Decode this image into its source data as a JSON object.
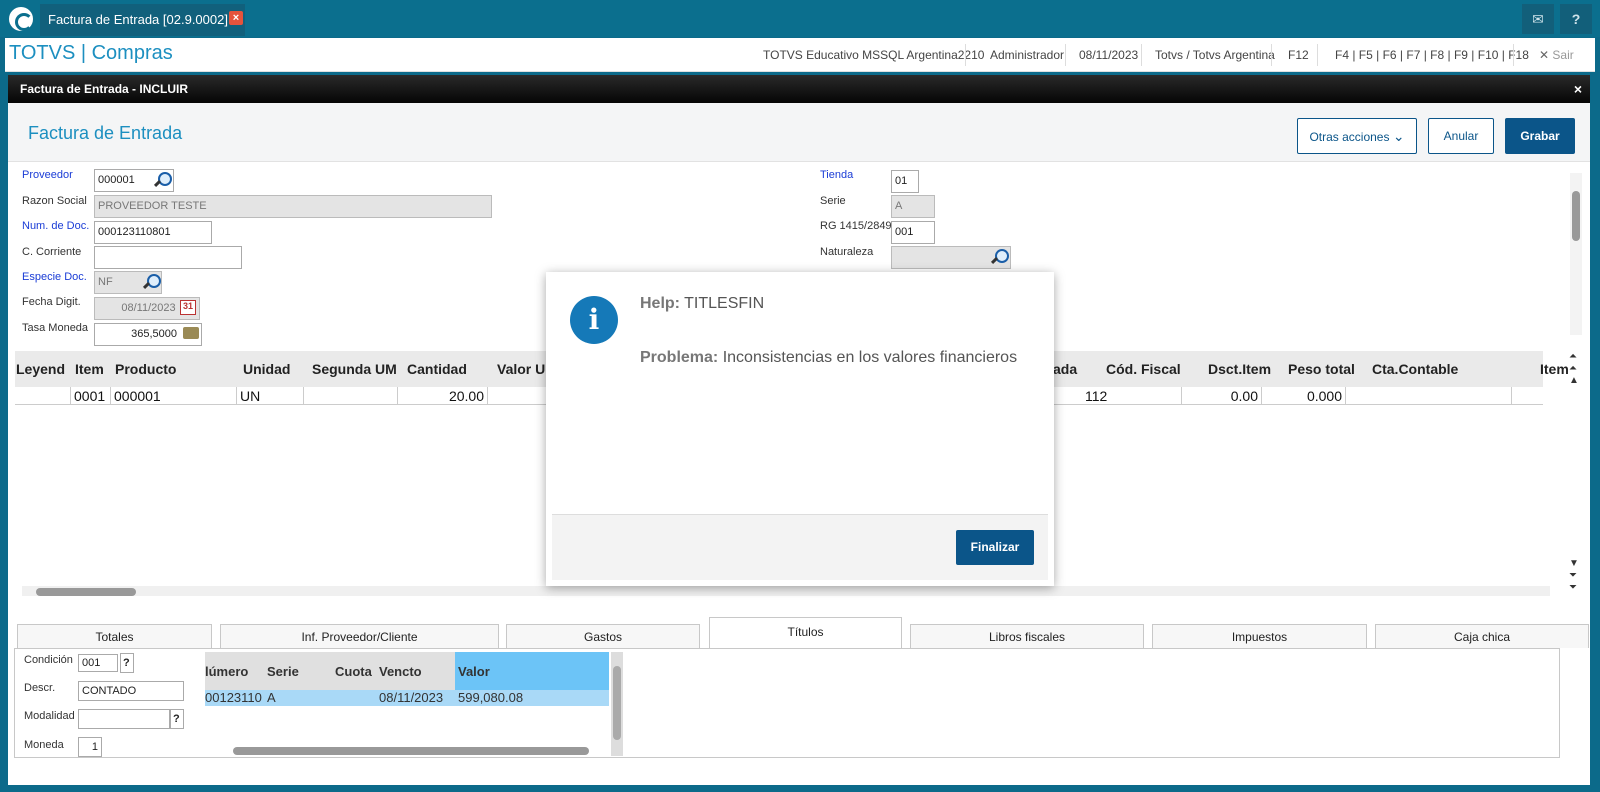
{
  "browser": {
    "tab_title": "Factura de Entrada [02.9.0002]",
    "tab_close": "×",
    "mail_icon": "✉",
    "help_icon": "?"
  },
  "header": {
    "brand": "TOTVS | Compras",
    "environment": "TOTVS Educativo MSSQL Argentina2210",
    "user": "Administrador",
    "date": "08/11/2023",
    "company": "Totvs / Totvs Argentina",
    "f12": "F12",
    "shortcuts": "F4 | F5 | F6 | F7 | F8 | F9 | F10 | F18",
    "exit": "Sair",
    "exit_icon": "✕"
  },
  "window": {
    "title": "Factura de Entrada - INCLUIR",
    "close": "×"
  },
  "page": {
    "title": "Factura de Entrada",
    "more_actions": "Otras acciones",
    "cancel": "Anular",
    "save": "Grabar"
  },
  "form": {
    "proveedor_label": "Proveedor",
    "proveedor_value": "000001",
    "razon_label": "Razon Social",
    "razon_value": "PROVEEDOR TESTE",
    "numdoc_label": "Num. de Doc.",
    "numdoc_value": "000123110801",
    "ccorriente_label": "C. Corriente",
    "ccorriente_value": "",
    "especie_label": "Especie Doc.",
    "especie_value": "NF",
    "fecha_label": "Fecha Digit.",
    "fecha_value": "08/11/2023",
    "tasa_label": "Tasa Moneda",
    "tasa_value": "365,5000",
    "tienda_label": "Tienda",
    "tienda_value": "01",
    "serie_label": "Serie",
    "serie_value": "A",
    "rg_label": "RG 1415/2849",
    "rg_value": "001",
    "naturaleza_label": "Naturaleza",
    "naturaleza_value": ""
  },
  "grid": {
    "headers": {
      "leyend": "Leyend",
      "item": "Item",
      "producto": "Producto",
      "unidad": "Unidad",
      "segunda": "Segunda UM",
      "cantidad": "Cantidad",
      "valor": "Valor Un",
      "ada": "ada",
      "codfiscal": "Cód. Fiscal",
      "dsct": "Dsct.Item",
      "peso": "Peso total",
      "cta": "Cta.Contable",
      "item2": "Item"
    },
    "row": {
      "item": "0001",
      "producto": "000001",
      "unidad": "UN",
      "cantidad": "20.00",
      "codfiscal": "112",
      "dsct": "0.00",
      "peso": "0.000"
    }
  },
  "tabs": [
    "Totales",
    "Inf. Proveedor/Cliente",
    "Gastos",
    "Títulos",
    "Libros fiscales",
    "Impuestos",
    "Caja chica"
  ],
  "titulos": {
    "condicion_label": "Condición",
    "condicion_value": "001",
    "descr_label": "Descr.",
    "descr_value": "CONTADO",
    "modalidad_label": "Modalidad",
    "modalidad_value": "",
    "moneda_label": "Moneda",
    "moneda_value": "1",
    "help_btn": "?",
    "table_headers": [
      "lúmero",
      "Serie",
      "Cuota",
      "Vencto",
      "Valor"
    ],
    "row": [
      "00123110",
      "A",
      "",
      "08/11/2023",
      "599,080.08"
    ]
  },
  "modal": {
    "icon_glyph": "i",
    "help_label": "Help:",
    "help_value": "TITLESFIN",
    "problem_label": "Problema:",
    "problem_value": "Inconsistencias en los valores financieros",
    "finalize": "Finalizar"
  }
}
